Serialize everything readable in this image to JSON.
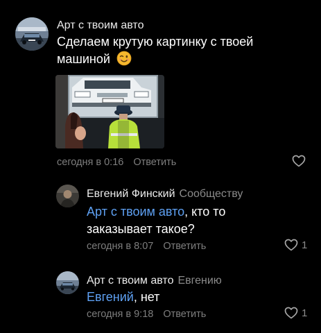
{
  "comments": [
    {
      "author": "Арт с твоим авто",
      "text_line1": "Сделаем крутую картинку с твоей",
      "text_line2": "машиной",
      "emoji": "winking-face-emoji",
      "time": "сегодня в 0:16",
      "reply_label": "Ответить",
      "likes": ""
    },
    {
      "author": "Евгений Финский",
      "reply_to": "Сообществу",
      "mention": "Арт с твоим авто",
      "text_rest": ", кто то",
      "text_line2": "заказывает такое?",
      "time": "сегодня в 8:07",
      "reply_label": "Ответить",
      "likes": "1"
    },
    {
      "author": "Арт с твоим авто",
      "reply_to": "Евгению",
      "mention": "Евгений",
      "text_rest": ", нет",
      "time": "сегодня в 9:18",
      "reply_label": "Ответить",
      "likes": "1"
    }
  ],
  "colors": {
    "background": "#000000",
    "mention": "#5ea0f2",
    "meta": "#7e7e7e"
  },
  "icons": {
    "like": "heart-icon"
  }
}
